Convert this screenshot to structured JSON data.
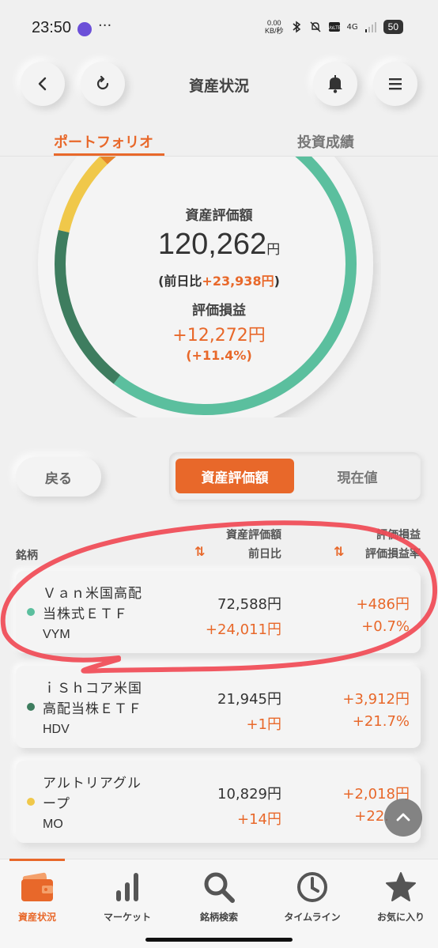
{
  "status_bar": {
    "time": "23:50",
    "more": "···",
    "speed_value": "0.00",
    "speed_unit": "KB/秒",
    "network": "4G",
    "battery": "50"
  },
  "header": {
    "title": "資産状況",
    "icons": [
      "chevron-left-icon",
      "refresh-icon",
      "bell-icon",
      "menu-icon"
    ]
  },
  "tabs": [
    {
      "label": "ポートフォリオ",
      "active": true
    },
    {
      "label": "投資成績",
      "active": false
    }
  ],
  "summary": {
    "total_label": "資産評価額",
    "total_value": "120,262",
    "total_unit": "円",
    "day_change_prefix": "(前日比",
    "day_change_value": "+23,938円",
    "day_change_suffix": ")",
    "pl_label": "評価損益",
    "pl_value": "+12,272円",
    "pl_pct": "(+11.4%)"
  },
  "donut": {
    "segments": [
      {
        "color": "#5bbf9e",
        "fraction": 0.604
      },
      {
        "color": "#3e7d5f",
        "fraction": 0.182
      },
      {
        "color": "#f0c84a",
        "fraction": 0.09
      },
      {
        "color": "#e8862a",
        "fraction": 0.03
      }
    ]
  },
  "controls": {
    "back_label": "戻る",
    "seg_active": "資産評価額",
    "seg_inactive": "現在値"
  },
  "table_header": {
    "name": "銘柄",
    "value": "資産評価額",
    "day": "前日比",
    "pl": "評価損益",
    "pl_rate": "評価損益率",
    "sort_icon": "⇅"
  },
  "holdings": [
    {
      "name_line1": "Ｖａｎ米国高配",
      "name_line2": "当株式ＥＴＦ",
      "ticker": "VYM",
      "value": "72,588円",
      "day": "+24,011円",
      "pl": "+486円",
      "pl_rate": "+0.7%",
      "color": "#5bbf9e"
    },
    {
      "name_line1": "ｉＳｈコア米国",
      "name_line2": "高配当株ＥＴＦ",
      "ticker": "HDV",
      "value": "21,945円",
      "day": "+1円",
      "pl": "+3,912円",
      "pl_rate": "+21.7%",
      "color": "#3e7d5f"
    },
    {
      "name_line1": "アルトリアグル",
      "name_line2": "ープ",
      "ticker": "MO",
      "value": "10,829円",
      "day": "+14円",
      "pl": "+2,018円",
      "pl_rate": "+22.",
      "color": "#f0c84a"
    }
  ],
  "bottom_nav": [
    {
      "label": "資産状況",
      "icon": "wallet-icon",
      "active": true
    },
    {
      "label": "マーケット",
      "icon": "bar-chart-icon",
      "active": false
    },
    {
      "label": "銘柄検索",
      "icon": "search-icon",
      "active": false
    },
    {
      "label": "タイムライン",
      "icon": "clock-icon",
      "active": false
    },
    {
      "label": "お気に入り",
      "icon": "star-icon",
      "active": false
    }
  ]
}
